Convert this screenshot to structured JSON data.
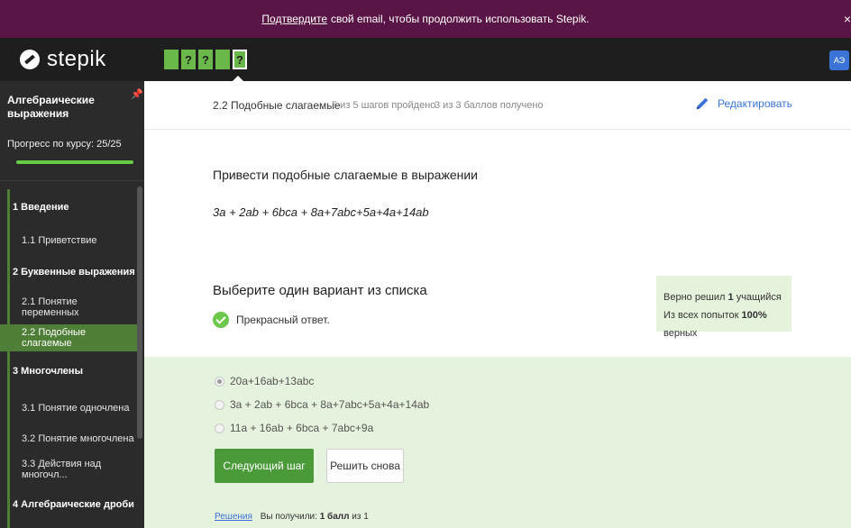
{
  "banner": {
    "link": "Подтвердите",
    "text": "свой email, чтобы продолжить использовать Stepik.",
    "close": "×"
  },
  "header": {
    "brand": "stepik",
    "steps": [
      "",
      "?",
      "?",
      "",
      "?"
    ],
    "avatar": "АЭ"
  },
  "sidebar": {
    "course_title": "Алгебраические выражения",
    "pin": "📌",
    "progress_label": "Прогресс по курсу: 25/25",
    "progress": 1.0,
    "nav": [
      {
        "type": "section",
        "label": "1 Введение"
      },
      {
        "type": "lesson",
        "label": "1.1 Приветствие"
      },
      {
        "type": "section",
        "label": "2 Буквенные выражения"
      },
      {
        "type": "lesson",
        "label": "2.1 Понятие переменных"
      },
      {
        "type": "lesson",
        "label": "2.2 Подобные слагаемые",
        "active": true
      },
      {
        "type": "section",
        "label": "3 Многочлены"
      },
      {
        "type": "lesson",
        "label": "3.1 Понятие одночлена"
      },
      {
        "type": "lesson",
        "label": "3.2 Понятие многочлена"
      },
      {
        "type": "lesson",
        "label": "3.3 Действия над многочл..."
      },
      {
        "type": "section",
        "label": "4 Алгебраические дроби"
      }
    ]
  },
  "lesson": {
    "title": "2.2 Подобные слагаемые",
    "steps_done": "5 из 5 шагов пройдено",
    "points": "3 из 3 баллов получено",
    "edit": "Редактировать"
  },
  "task": {
    "title": "Привести подобные слагаемые в выражении",
    "expression": "3a + 2ab + 6bca + 8a+7abc+5a+4a+14ab",
    "choose": "Выберите один вариант из списка",
    "success": "Прекрасный ответ.",
    "stats_line1_pre": "Верно решил",
    "stats_line1_num": "1",
    "stats_line1_post": "учащийся",
    "stats_line2_pre": "Из всех попыток",
    "stats_line2_num": "100%",
    "stats_line2_post": "верных",
    "options": [
      {
        "label": "20a+16ab+13abc",
        "checked": true
      },
      {
        "label": "3a + 2ab + 6bca + 8a+7abc+5a+4a+14ab",
        "checked": false
      },
      {
        "label": "11a + 16ab + 6bca + 7abc+9a",
        "checked": false
      }
    ],
    "next_button": "Следующий шаг",
    "retry_button": "Решить снова",
    "solutions_link": "Решения",
    "received_pre": "Вы получили:",
    "received_bold": "1 балл",
    "received_post": "из 1"
  },
  "colors": {
    "banner": "#5a1547",
    "accent_green": "#4a9a3a",
    "link_blue": "#3b73d6"
  }
}
